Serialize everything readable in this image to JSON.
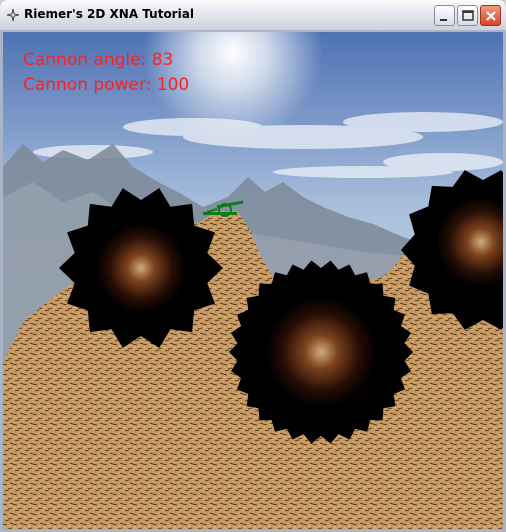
{
  "window": {
    "title": "Riemer's 2D XNA Tutorial"
  },
  "hud": {
    "angle_text": "Cannon angle: 83",
    "power_text": "Cannon power: 100",
    "text_color": "#ff2020"
  },
  "icons": {
    "app": "xna-app-icon",
    "minimize": "minimize-icon",
    "maximize": "maximize-icon",
    "close": "close-icon"
  },
  "scene": {
    "sky_color": "#6f8fc4",
    "terrain_color": "#c99a62",
    "crater_color": "#000000",
    "cannon_color": "#0b7d1a",
    "player_count": 1
  }
}
